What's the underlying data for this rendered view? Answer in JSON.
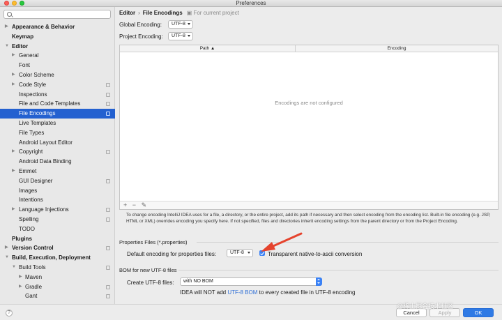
{
  "window": {
    "title": "Preferences"
  },
  "search": {
    "placeholder": "",
    "value": ""
  },
  "sidebar": {
    "items": [
      {
        "label": "Appearance & Behavior",
        "level": 0,
        "arrow": "▶",
        "bold": true,
        "proj": false
      },
      {
        "label": "Keymap",
        "level": 0,
        "arrow": "",
        "bold": true,
        "proj": false
      },
      {
        "label": "Editor",
        "level": 0,
        "arrow": "▼",
        "bold": true,
        "proj": false
      },
      {
        "label": "General",
        "level": 1,
        "arrow": "▶",
        "bold": false,
        "proj": false
      },
      {
        "label": "Font",
        "level": 1,
        "arrow": "",
        "bold": false,
        "proj": false
      },
      {
        "label": "Color Scheme",
        "level": 1,
        "arrow": "▶",
        "bold": false,
        "proj": false
      },
      {
        "label": "Code Style",
        "level": 1,
        "arrow": "▶",
        "bold": false,
        "proj": true
      },
      {
        "label": "Inspections",
        "level": 1,
        "arrow": "",
        "bold": false,
        "proj": true
      },
      {
        "label": "File and Code Templates",
        "level": 1,
        "arrow": "",
        "bold": false,
        "proj": true
      },
      {
        "label": "File Encodings",
        "level": 1,
        "arrow": "",
        "bold": false,
        "proj": true,
        "selected": true
      },
      {
        "label": "Live Templates",
        "level": 1,
        "arrow": "",
        "bold": false,
        "proj": false
      },
      {
        "label": "File Types",
        "level": 1,
        "arrow": "",
        "bold": false,
        "proj": false
      },
      {
        "label": "Android Layout Editor",
        "level": 1,
        "arrow": "",
        "bold": false,
        "proj": false
      },
      {
        "label": "Copyright",
        "level": 1,
        "arrow": "▶",
        "bold": false,
        "proj": true
      },
      {
        "label": "Android Data Binding",
        "level": 1,
        "arrow": "",
        "bold": false,
        "proj": false
      },
      {
        "label": "Emmet",
        "level": 1,
        "arrow": "▶",
        "bold": false,
        "proj": false
      },
      {
        "label": "GUI Designer",
        "level": 1,
        "arrow": "",
        "bold": false,
        "proj": true
      },
      {
        "label": "Images",
        "level": 1,
        "arrow": "",
        "bold": false,
        "proj": false
      },
      {
        "label": "Intentions",
        "level": 1,
        "arrow": "",
        "bold": false,
        "proj": false
      },
      {
        "label": "Language Injections",
        "level": 1,
        "arrow": "▶",
        "bold": false,
        "proj": true
      },
      {
        "label": "Spelling",
        "level": 1,
        "arrow": "",
        "bold": false,
        "proj": true
      },
      {
        "label": "TODO",
        "level": 1,
        "arrow": "",
        "bold": false,
        "proj": false
      },
      {
        "label": "Plugins",
        "level": 0,
        "arrow": "",
        "bold": true,
        "proj": false
      },
      {
        "label": "Version Control",
        "level": 0,
        "arrow": "▶",
        "bold": true,
        "proj": true
      },
      {
        "label": "Build, Execution, Deployment",
        "level": 0,
        "arrow": "▼",
        "bold": true,
        "proj": false
      },
      {
        "label": "Build Tools",
        "level": 1,
        "arrow": "▼",
        "bold": false,
        "proj": true
      },
      {
        "label": "Maven",
        "level": 2,
        "arrow": "▶",
        "bold": false,
        "proj": false
      },
      {
        "label": "Gradle",
        "level": 2,
        "arrow": "▶",
        "bold": false,
        "proj": true
      },
      {
        "label": "Gant",
        "level": 2,
        "arrow": "",
        "bold": false,
        "proj": true
      }
    ]
  },
  "breadcrumb": {
    "parent": "Editor",
    "separator": "›",
    "current": "File Encodings",
    "note": "For current project"
  },
  "global_encoding": {
    "label": "Global Encoding:",
    "value": "UTF-8"
  },
  "project_encoding": {
    "label": "Project Encoding:",
    "value": "UTF-8"
  },
  "table": {
    "columns": [
      "Path ▲",
      "Encoding"
    ],
    "empty_text": "Encodings are not configured",
    "tools": [
      "+",
      "−",
      "✎"
    ]
  },
  "help_text": "To change encoding IntelliJ IDEA uses for a file, a directory, or the entire project, add its path if necessary and then select encoding from the encoding list. Built-in file encoding (e.g. JSP, HTML or XML) overrides encoding you specify here. If not specified, files and directories inherit encoding settings from the parent directory or from the Project Encoding.",
  "properties": {
    "section_title": "Properties Files (*.properties)",
    "default_label": "Default encoding for properties files:",
    "default_value": "UTF-8",
    "checkbox_label": "Transparent native-to-ascii conversion",
    "checked": true
  },
  "bom": {
    "section_title": "BOM for new UTF-8 files",
    "create_label": "Create UTF-8 files:",
    "create_value": "with NO BOM",
    "note_prefix": "IDEA will NOT add ",
    "note_link": "UTF-8 BOM",
    "note_suffix": " to every created file in UTF-8 encoding"
  },
  "footer": {
    "help": "?",
    "cancel": "Cancel",
    "apply": "Apply",
    "ok": "OK"
  },
  "watermark": "@稀土掘金技术社区",
  "colors": {
    "selection": "#2461d0",
    "accent": "#3b82f6",
    "arrow": "#e5432d"
  }
}
